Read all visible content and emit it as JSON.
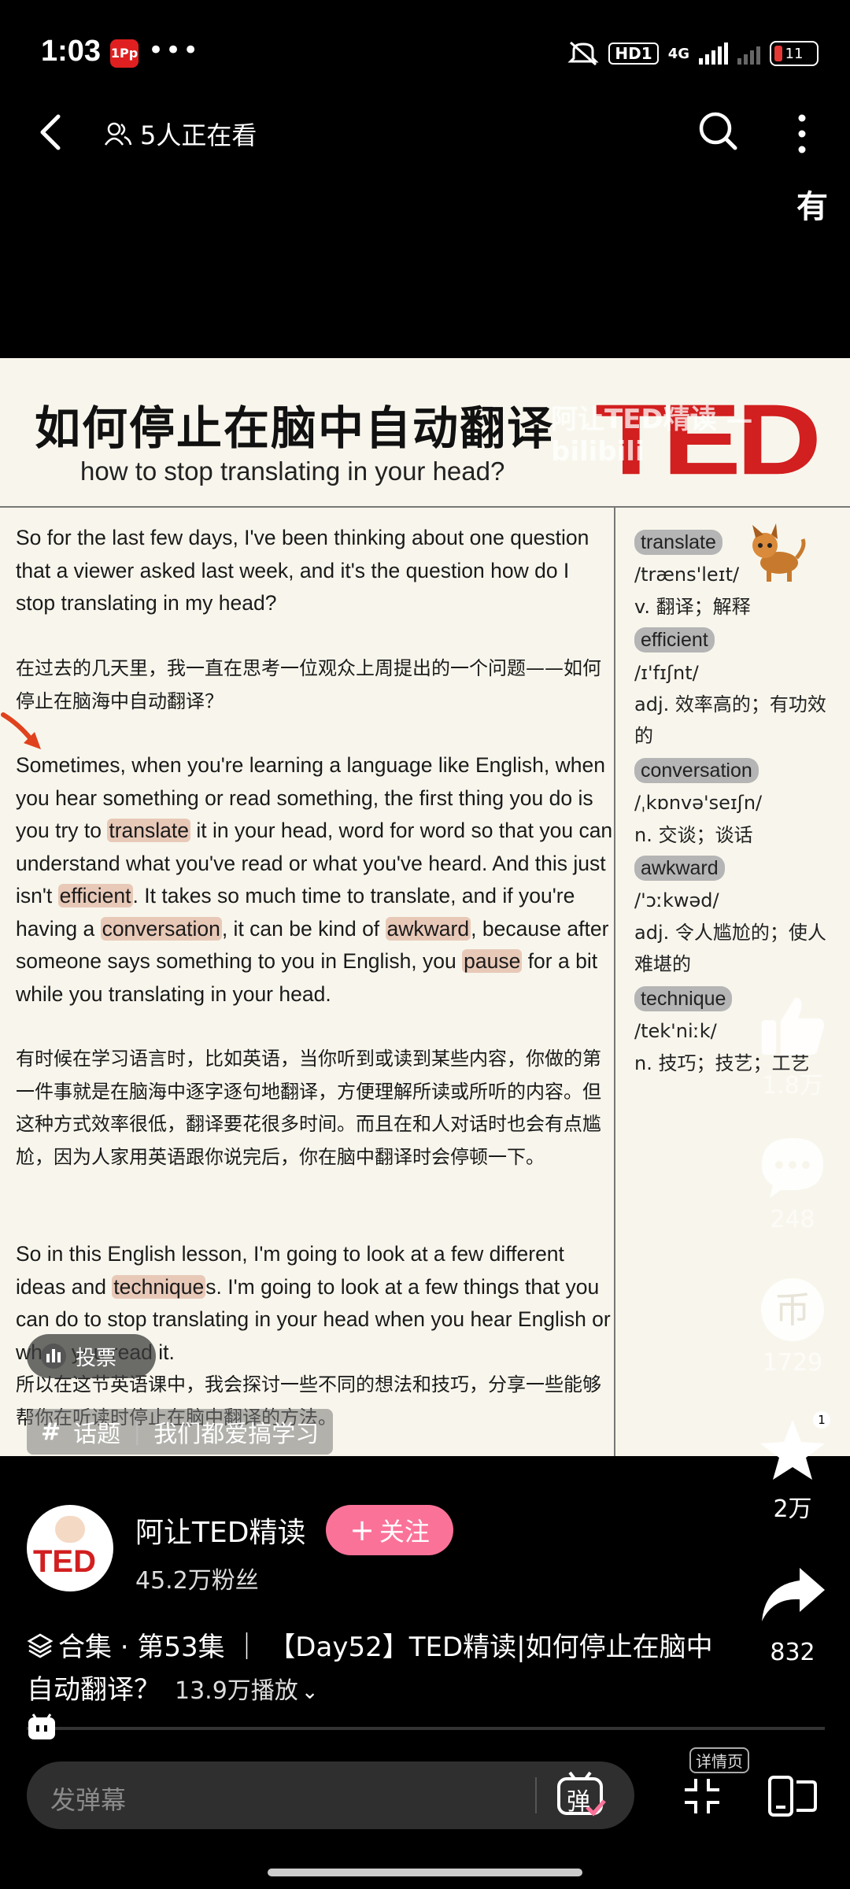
{
  "status_bar": {
    "time": "1:03",
    "app_badge": "1Pp",
    "more": "•••",
    "hd": "HD1",
    "net": "4G",
    "battery": "11"
  },
  "nav": {
    "watching": "5人正在看",
    "overlay_char": "有"
  },
  "video": {
    "title": "如何停止在脑中自动翻译",
    "subtitle": "how to stop translating in your head?",
    "logo": "TED",
    "watermark": "阿让TED精读 — bilibili",
    "p1": "So for the last few days, I've been thinking about one question that a viewer asked last week, and it's the question how do I stop translating in my head?",
    "p1_cn": "在过去的几天里，我一直在思考一位观众上周提出的一个问题——如何停止在脑海中自动翻译？",
    "p2": {
      "a": "Sometimes, when you're learning a language like English, when you hear something or read something, the first thing you do is you try to ",
      "h1": "translate",
      "b": " it in your head, word for word so that you can understand what you've read or what you've heard. And this just isn't ",
      "h2": "efficient",
      "c": ". It takes so much time to translate, and if you're having a ",
      "h3": "conversation",
      "d": ", it can be kind of ",
      "h4": "awkward",
      "e": ", because after someone says something to you in English, you ",
      "h5": "pause",
      "f": " for a bit while you translating in your head."
    },
    "p2_cn": "有时候在学习语言时，比如英语，当你听到或读到某些内容，你做的第一件事就是在脑海中逐字逐句地翻译，方便理解所读或所听的内容。但这种方式效率很低，翻译要花很多时间。而且在和人对话时也会有点尴尬，因为人家用英语跟你说完后，你在脑中翻译时会停顿一下。",
    "p3": {
      "a": "So in this English lesson, I'm going to look at a few different ideas and ",
      "h1": "technique",
      "b": "s. I'm going to look at a few things that you can do to stop translating in your head when you hear English or when you read it."
    },
    "p3_cn": "所以在这节英语课中，我会探讨一些不同的想法和技巧，分享一些能够帮你在听读时停止在脑中翻译的方法。",
    "vocab": [
      {
        "word": "translate",
        "ipa": "/træns'leɪt/",
        "def": "v. 翻译；解释"
      },
      {
        "word": "efficient",
        "ipa": "/ɪ'fɪʃnt/",
        "def": "adj. 效率高的；有功效的"
      },
      {
        "word": "conversation",
        "ipa": "/ˌkɒnvə'seɪʃn/",
        "def": "n. 交谈；谈话"
      },
      {
        "word": "awkward",
        "ipa": "/'ɔːkwəd/",
        "def": "adj. 令人尴尬的；使人难堪的"
      },
      {
        "word": "technique",
        "ipa": "/tek'niːk/",
        "def": "n. 技巧；技艺；工艺"
      }
    ],
    "vote_label": "投票",
    "topic_label": "话题",
    "topic_name": "我们都爱搞学习"
  },
  "rail": {
    "likes": "1.8万",
    "comments": "248",
    "coins": "1729",
    "fav_badge": "1",
    "favs": "2万",
    "shares": "832"
  },
  "author": {
    "name": "阿让TED精读",
    "fans": "45.2万粉丝",
    "follow": "关注",
    "avatar_text": "TED"
  },
  "collection": {
    "text": "合集 · 第53集 ｜ 【Day52】TED精读|如何停止在脑中自动翻译？",
    "plays": "13.9万播放"
  },
  "playback": {
    "progress": 0.0
  },
  "bottom": {
    "danmu_placeholder": "发弹幕",
    "danmu_btn": "弹",
    "detail_label": "详情页"
  }
}
